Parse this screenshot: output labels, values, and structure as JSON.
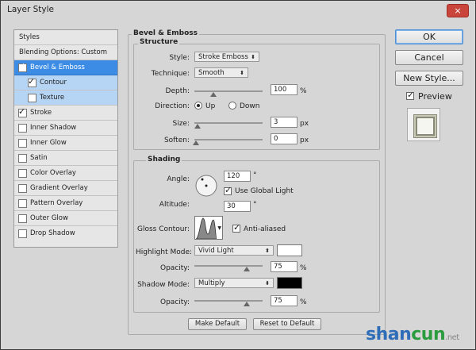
{
  "window": {
    "title": "Layer Style",
    "close_glyph": "×"
  },
  "left_panel": {
    "header": "Styles",
    "blending": "Blending Options: Custom",
    "items": [
      {
        "label": "Bevel & Emboss",
        "checked": true
      },
      {
        "label": "Contour",
        "checked": true
      },
      {
        "label": "Texture",
        "checked": false
      },
      {
        "label": "Stroke",
        "checked": true
      },
      {
        "label": "Inner Shadow",
        "checked": false
      },
      {
        "label": "Inner Glow",
        "checked": false
      },
      {
        "label": "Satin",
        "checked": false
      },
      {
        "label": "Color Overlay",
        "checked": false
      },
      {
        "label": "Gradient Overlay",
        "checked": false
      },
      {
        "label": "Pattern Overlay",
        "checked": false
      },
      {
        "label": "Outer Glow",
        "checked": false
      },
      {
        "label": "Drop Shadow",
        "checked": false
      }
    ]
  },
  "bevel": {
    "title": "Bevel & Emboss",
    "structure": {
      "title": "Structure",
      "style_label": "Style:",
      "style_value": "Stroke Emboss",
      "technique_label": "Technique:",
      "technique_value": "Smooth",
      "depth_label": "Depth:",
      "depth_value": "100",
      "depth_unit": "%",
      "direction_label": "Direction:",
      "up": "Up",
      "down": "Down",
      "direction_selected": "Up",
      "size_label": "Size:",
      "size_value": "3",
      "size_unit": "px",
      "soften_label": "Soften:",
      "soften_value": "0",
      "soften_unit": "px"
    },
    "shading": {
      "title": "Shading",
      "angle_label": "Angle:",
      "angle_value": "120",
      "angle_unit": "°",
      "use_global": "Use Global Light",
      "use_global_checked": true,
      "altitude_label": "Altitude:",
      "altitude_value": "30",
      "altitude_unit": "°",
      "gloss_label": "Gloss Contour:",
      "anti_aliased": "Anti-aliased",
      "anti_aliased_checked": true,
      "highlight_label": "Highlight Mode:",
      "highlight_value": "Vivid Light",
      "highlight_color": "#ffffff",
      "opacity_label": "Opacity:",
      "highlight_opacity": "75",
      "opacity_unit": "%",
      "shadow_label": "Shadow Mode:",
      "shadow_value": "Multiply",
      "shadow_color": "#000000",
      "shadow_opacity": "75"
    },
    "make_default": "Make Default",
    "reset_default": "Reset to Default"
  },
  "buttons": {
    "ok": "OK",
    "cancel": "Cancel",
    "new_style": "New Style...",
    "preview": "Preview",
    "preview_checked": true
  },
  "watermark": {
    "a": "shan",
    "b": "cun",
    "c": ".net"
  }
}
